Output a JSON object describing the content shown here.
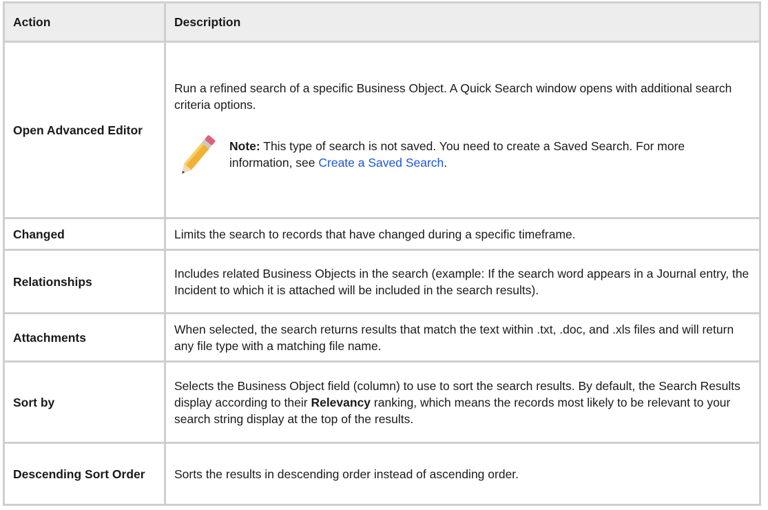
{
  "table": {
    "headers": {
      "action": "Action",
      "description": "Description"
    },
    "rows": [
      {
        "action": "Open Advanced Editor",
        "description": "Run a refined search of a specific Business Object. A Quick Search window opens with additional search criteria options.",
        "note": {
          "label": "Note:",
          "text_before": " This type of search is not saved. You need to create a Saved Search. For more information, see ",
          "link": "Create a Saved Search",
          "text_after": "."
        }
      },
      {
        "action": "Changed",
        "description": "Limits the search to records that have changed during a specific timeframe."
      },
      {
        "action": "Relationships",
        "description": "Includes related Business Objects in the search (example: If the search word appears in a Journal entry, the Incident to which it is attached will be included in the search results)."
      },
      {
        "action": "Attachments",
        "description": "When selected, the search returns results that match the text within .txt, .doc, and .xls files and will return any file type with a matching file name."
      },
      {
        "action": "Sort by",
        "description_before": "Selects the Business Object field (column) to use to sort the search results. By default, the Search Results display according to their ",
        "description_bold": "Relevancy",
        "description_after": " ranking, which means the records most likely to be relevant to your search string display at the top of the results."
      },
      {
        "action": "Descending Sort Order",
        "description": "Sorts the results in descending order instead of ascending order."
      }
    ]
  },
  "icons": {
    "note_icon": "pencil-icon"
  },
  "colors": {
    "header_bg": "#ededed",
    "border": "#cfcfcf",
    "link": "#1a56db"
  }
}
